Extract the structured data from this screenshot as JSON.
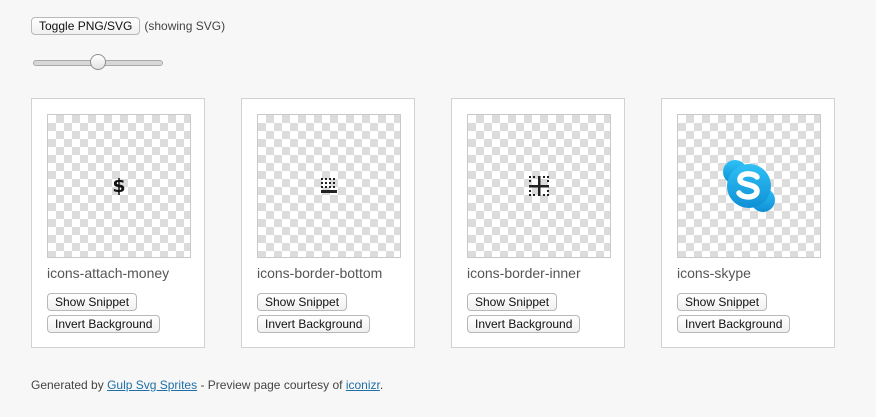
{
  "toolbar": {
    "toggle_label": "Toggle PNG/SVG",
    "toggle_note": "(showing SVG)"
  },
  "slider": {
    "value_fraction": 0.5
  },
  "cards": [
    {
      "name": "icons-attach-money",
      "icon": "attach-money-icon",
      "snippet_label": "Show Snippet",
      "invert_label": "Invert Background"
    },
    {
      "name": "icons-border-bottom",
      "icon": "border-bottom-icon",
      "snippet_label": "Show Snippet",
      "invert_label": "Invert Background"
    },
    {
      "name": "icons-border-inner",
      "icon": "border-inner-icon",
      "snippet_label": "Show Snippet",
      "invert_label": "Invert Background"
    },
    {
      "name": "icons-skype",
      "icon": "skype-icon",
      "snippet_label": "Show Snippet",
      "invert_label": "Invert Background"
    }
  ],
  "icons": {
    "dollar_glyph": "$",
    "skype_color": "#1aa9e8"
  },
  "footer": {
    "prefix": "Generated by ",
    "link1": "Gulp Svg Sprites",
    "middle": " - Preview page courtesy of ",
    "link2": "iconizr",
    "suffix": "."
  },
  "colors": {
    "link": "#1f6ea6",
    "background": "#f7f7f7"
  }
}
